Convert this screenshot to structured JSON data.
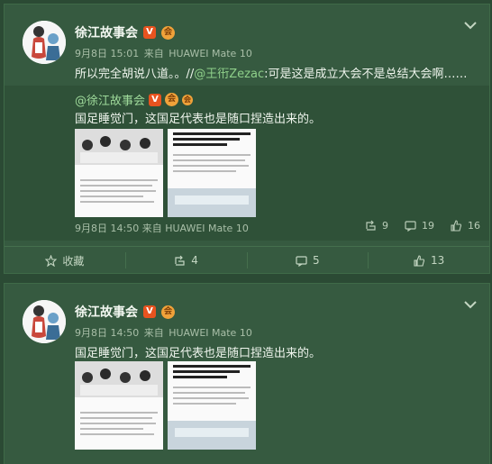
{
  "posts": [
    {
      "user": "徐江故事会",
      "badge_v": "V",
      "badge_o": "会",
      "time": "9月8日 15:01",
      "source_prefix": "来自",
      "device": "HUAWEI Mate 10",
      "text_pre": "所以完全胡说八道。。//",
      "text_mention": "@王衎Zezac",
      "text_post": ":可是这是成立大会不是总结大会啊……",
      "repost": {
        "user": "@徐江故事会",
        "badge_v": "V",
        "badge_o": "会",
        "badge_extra": "会",
        "text": "国足睡觉门，这国足代表也是随口捏造出来的。",
        "time": "9月8日 14:50",
        "source_prefix": "来自",
        "device": "HUAWEI Mate 10",
        "reposts": "9",
        "comments": "19",
        "likes": "16"
      },
      "actions": {
        "favorite": "收藏",
        "repost": "4",
        "comment": "5",
        "like": "13"
      }
    },
    {
      "user": "徐江故事会",
      "badge_v": "V",
      "badge_o": "会",
      "time": "9月8日 14:50",
      "source_prefix": "来自",
      "device": "HUAWEI Mate 10",
      "text": "国足睡觉门，这国足代表也是随口捏造出来的。"
    }
  ],
  "colors": {
    "accent_green": "#8fd08a",
    "badge_orange": "#e8531f",
    "badge_gold": "#f0a23a"
  },
  "icons": [
    "chevron-down-icon",
    "star-icon",
    "repost-icon",
    "comment-icon",
    "like-icon"
  ]
}
